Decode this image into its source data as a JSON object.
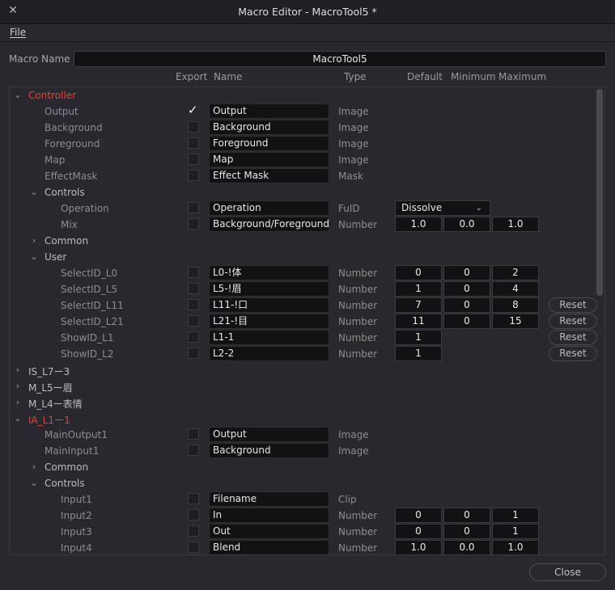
{
  "window": {
    "title": "Macro Editor - MacroTool5 *",
    "close_icon": "close-icon"
  },
  "menu": {
    "file": "File"
  },
  "macro_name": {
    "label": "Macro Name",
    "value": "MacroTool5"
  },
  "headers": {
    "export": "Export",
    "name": "Name",
    "type": "Type",
    "default": "Default",
    "minimum": "Minimum",
    "maximum": "Maximum"
  },
  "tree": {
    "controller": "Controller",
    "output": {
      "label": "Output",
      "name": "Output",
      "type": "Image"
    },
    "background": {
      "label": "Background",
      "name": "Background",
      "type": "Image"
    },
    "foreground": {
      "label": "Foreground",
      "name": "Foreground",
      "type": "Image"
    },
    "map": {
      "label": "Map",
      "name": "Map",
      "type": "Image"
    },
    "effectmask": {
      "label": "EffectMask",
      "name": "Effect Mask",
      "type": "Mask"
    },
    "controls": "Controls",
    "operation": {
      "label": "Operation",
      "name": "Operation",
      "type": "FuID",
      "value": "Dissolve"
    },
    "mix": {
      "label": "Mix",
      "name": "Background/Foreground",
      "type": "Number",
      "default": "1.0",
      "min": "0.0",
      "max": "1.0"
    },
    "common": "Common",
    "user": "User",
    "sel0": {
      "label": "SelectID_L0",
      "name": "L0-!体",
      "type": "Number",
      "default": "0",
      "min": "0",
      "max": "2"
    },
    "sel5": {
      "label": "SelectID_L5",
      "name": "L5-!眉",
      "type": "Number",
      "default": "1",
      "min": "0",
      "max": "4"
    },
    "sel11": {
      "label": "SelectID_L11",
      "name": "L11-!口",
      "type": "Number",
      "default": "7",
      "min": "0",
      "max": "8",
      "reset": "Reset"
    },
    "sel21": {
      "label": "SelectID_L21",
      "name": "L21-!目",
      "type": "Number",
      "default": "11",
      "min": "0",
      "max": "15",
      "reset": "Reset"
    },
    "show1": {
      "label": "ShowID_L1",
      "name": "L1-1",
      "type": "Number",
      "default": "1",
      "reset": "Reset"
    },
    "show2": {
      "label": "ShowID_L2",
      "name": "L2-2",
      "type": "Number",
      "default": "1",
      "reset": "Reset"
    },
    "is_l7": "IS_L7ー3",
    "m_l5": "M_L5ー眉",
    "m_l4": "M_L4ー表情",
    "ia_l1": "IA_L1ー1",
    "mainoutput": {
      "label": "MainOutput1",
      "name": "Output",
      "type": "Image"
    },
    "maininput": {
      "label": "MainInput1",
      "name": "Background",
      "type": "Image"
    },
    "common2": "Common",
    "controls2": "Controls",
    "input1": {
      "label": "Input1",
      "name": "Filename",
      "type": "Clip"
    },
    "input2": {
      "label": "Input2",
      "name": "In",
      "type": "Number",
      "default": "0",
      "min": "0",
      "max": "1"
    },
    "input3": {
      "label": "Input3",
      "name": "Out",
      "type": "Number",
      "default": "0",
      "min": "0",
      "max": "1"
    },
    "input4": {
      "label": "Input4",
      "name": "Blend",
      "type": "Number",
      "default": "1.0",
      "min": "0.0",
      "max": "1.0"
    }
  },
  "footer": {
    "close": "Close"
  },
  "colors": {
    "accent_red": "#e0443a",
    "background": "#28282e",
    "field": "#121215"
  }
}
